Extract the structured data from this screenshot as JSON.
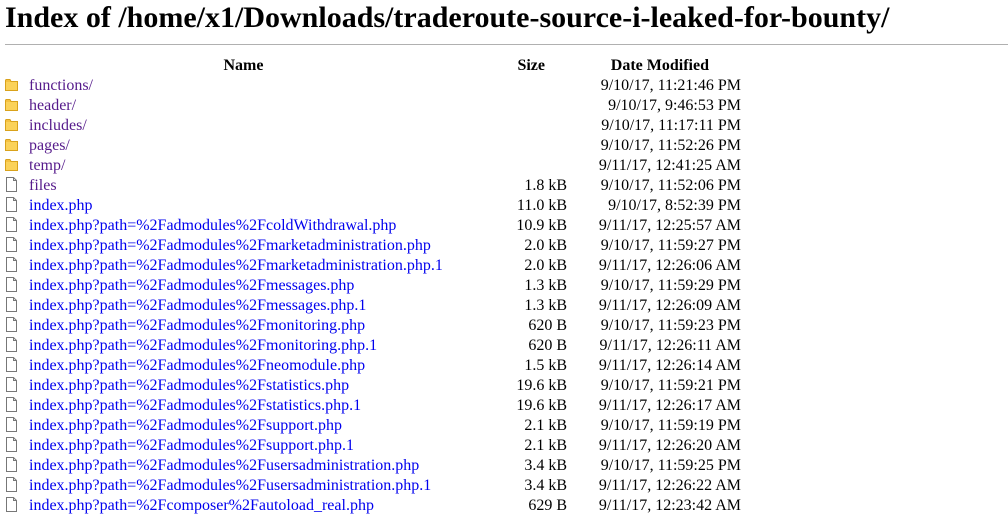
{
  "title": "Index of /home/x1/Downloads/traderoute-source-i-leaked-for-bounty/",
  "columns": {
    "name": "Name",
    "size": "Size",
    "date": "Date Modified"
  },
  "entries": [
    {
      "name": "functions/",
      "size": "",
      "date": "9/10/17, 11:21:46 PM",
      "type": "folder"
    },
    {
      "name": "header/",
      "size": "",
      "date": "9/10/17, 9:46:53 PM",
      "type": "folder"
    },
    {
      "name": "includes/",
      "size": "",
      "date": "9/10/17, 11:17:11 PM",
      "type": "folder"
    },
    {
      "name": "pages/",
      "size": "",
      "date": "9/10/17, 11:52:26 PM",
      "type": "folder"
    },
    {
      "name": "temp/",
      "size": "",
      "date": "9/11/17, 12:41:25 AM",
      "type": "folder"
    },
    {
      "name": "files",
      "size": "1.8 kB",
      "date": "9/10/17, 11:52:06 PM",
      "type": "file",
      "visited": true
    },
    {
      "name": "index.php",
      "size": "11.0 kB",
      "date": "9/10/17, 8:52:39 PM",
      "type": "file"
    },
    {
      "name": "index.php?path=%2Fadmodules%2FcoldWithdrawal.php",
      "size": "10.9 kB",
      "date": "9/11/17, 12:25:57 AM",
      "type": "file"
    },
    {
      "name": "index.php?path=%2Fadmodules%2Fmarketadministration.php",
      "size": "2.0 kB",
      "date": "9/10/17, 11:59:27 PM",
      "type": "file"
    },
    {
      "name": "index.php?path=%2Fadmodules%2Fmarketadministration.php.1",
      "size": "2.0 kB",
      "date": "9/11/17, 12:26:06 AM",
      "type": "file"
    },
    {
      "name": "index.php?path=%2Fadmodules%2Fmessages.php",
      "size": "1.3 kB",
      "date": "9/10/17, 11:59:29 PM",
      "type": "file"
    },
    {
      "name": "index.php?path=%2Fadmodules%2Fmessages.php.1",
      "size": "1.3 kB",
      "date": "9/11/17, 12:26:09 AM",
      "type": "file"
    },
    {
      "name": "index.php?path=%2Fadmodules%2Fmonitoring.php",
      "size": "620 B",
      "date": "9/10/17, 11:59:23 PM",
      "type": "file"
    },
    {
      "name": "index.php?path=%2Fadmodules%2Fmonitoring.php.1",
      "size": "620 B",
      "date": "9/11/17, 12:26:11 AM",
      "type": "file"
    },
    {
      "name": "index.php?path=%2Fadmodules%2Fneomodule.php",
      "size": "1.5 kB",
      "date": "9/11/17, 12:26:14 AM",
      "type": "file"
    },
    {
      "name": "index.php?path=%2Fadmodules%2Fstatistics.php",
      "size": "19.6 kB",
      "date": "9/10/17, 11:59:21 PM",
      "type": "file"
    },
    {
      "name": "index.php?path=%2Fadmodules%2Fstatistics.php.1",
      "size": "19.6 kB",
      "date": "9/11/17, 12:26:17 AM",
      "type": "file"
    },
    {
      "name": "index.php?path=%2Fadmodules%2Fsupport.php",
      "size": "2.1 kB",
      "date": "9/10/17, 11:59:19 PM",
      "type": "file"
    },
    {
      "name": "index.php?path=%2Fadmodules%2Fsupport.php.1",
      "size": "2.1 kB",
      "date": "9/11/17, 12:26:20 AM",
      "type": "file"
    },
    {
      "name": "index.php?path=%2Fadmodules%2Fusersadministration.php",
      "size": "3.4 kB",
      "date": "9/10/17, 11:59:25 PM",
      "type": "file"
    },
    {
      "name": "index.php?path=%2Fadmodules%2Fusersadministration.php.1",
      "size": "3.4 kB",
      "date": "9/11/17, 12:26:22 AM",
      "type": "file"
    },
    {
      "name": "index.php?path=%2Fcomposer%2Fautoload_real.php",
      "size": "629 B",
      "date": "9/11/17, 12:23:42 AM",
      "type": "file"
    }
  ],
  "icons": {
    "folder": "folder-icon",
    "file": "file-icon"
  },
  "colors": {
    "link": "#0000ee",
    "visited": "#551a8b",
    "folder": "#f5c242"
  }
}
